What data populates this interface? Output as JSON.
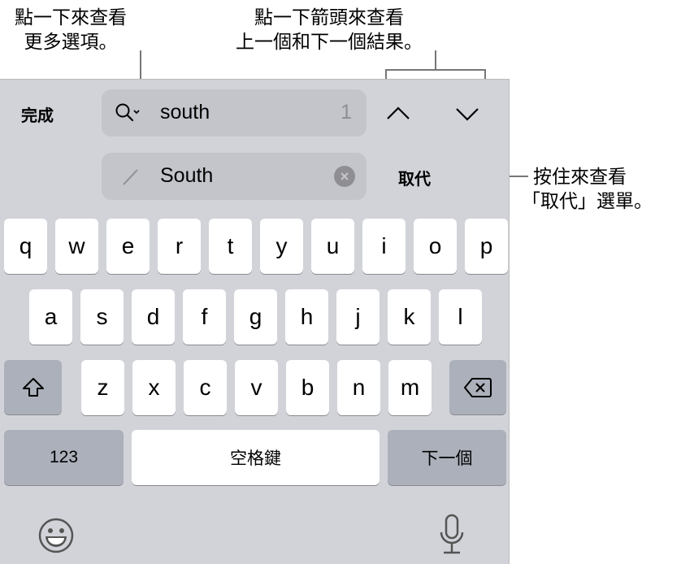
{
  "callouts": {
    "search_options": [
      "點一下來查看",
      "更多選項。"
    ],
    "arrows": [
      "點一下箭頭來查看",
      "上一個和下一個結果。"
    ],
    "replace": [
      "按住來查看",
      "「取代」選單。"
    ]
  },
  "toolbar": {
    "done_label": "完成",
    "search_value": "south",
    "match_count": "1",
    "replace_value": "South",
    "replace_label": "取代"
  },
  "keyboard": {
    "row1": [
      "q",
      "w",
      "e",
      "r",
      "t",
      "y",
      "u",
      "i",
      "o",
      "p"
    ],
    "row2": [
      "a",
      "s",
      "d",
      "f",
      "g",
      "h",
      "j",
      "k",
      "l"
    ],
    "row3": [
      "z",
      "x",
      "c",
      "v",
      "b",
      "n",
      "m"
    ],
    "numbers_label": "123",
    "space_label": "空格鍵",
    "next_label": "下一個"
  },
  "icons": {
    "search": "magnifier-with-chevron",
    "prev": "chevron-up",
    "next": "chevron-down",
    "edit": "pencil",
    "clear": "x-circle",
    "shift": "shift-arrow",
    "delete": "backspace",
    "emoji": "smiley-face",
    "dictation": "microphone"
  }
}
